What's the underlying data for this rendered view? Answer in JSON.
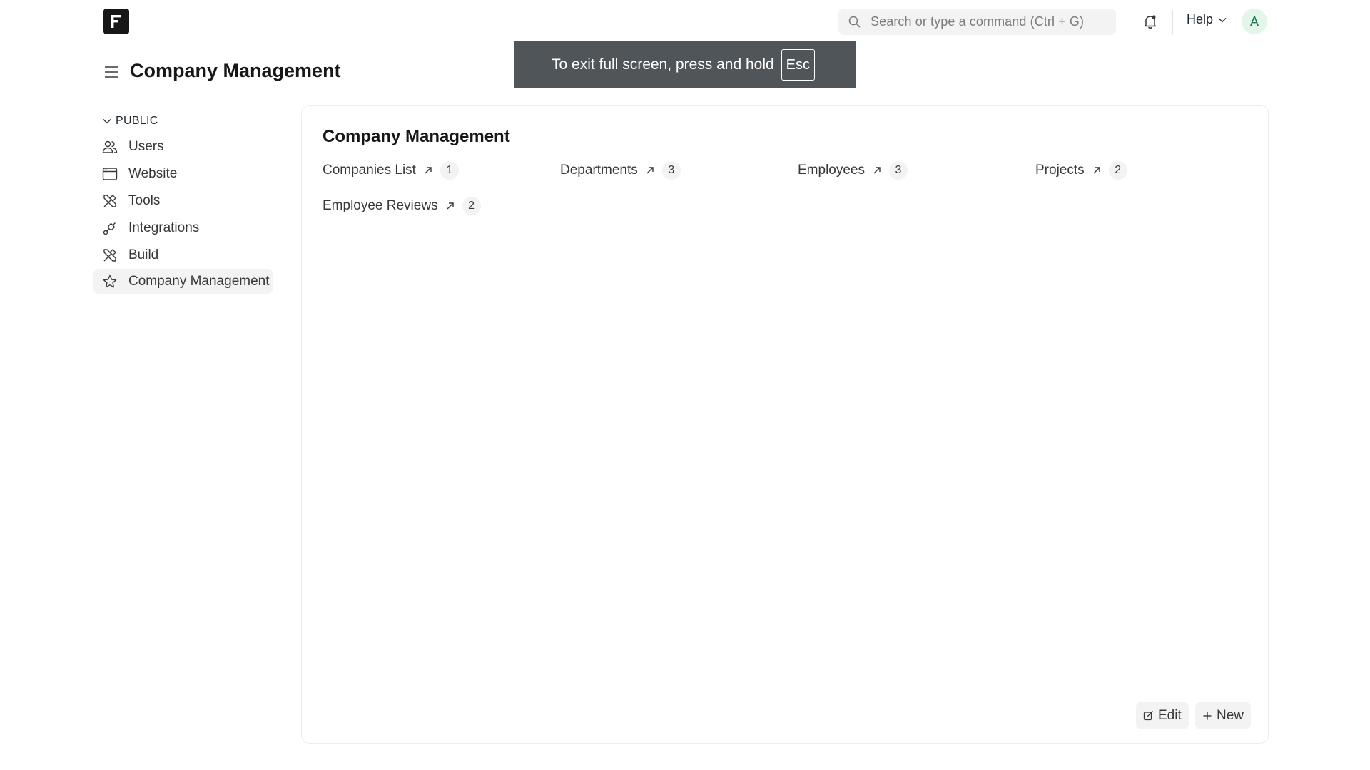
{
  "navbar": {
    "logo_icon": "frappe-logo-icon",
    "search_placeholder": "Search or type a command (Ctrl + G)",
    "help_label": "Help",
    "avatar_initial": "A"
  },
  "fullscreen_notice": {
    "text": "To exit full screen, press and hold",
    "key": "Esc"
  },
  "page": {
    "title": "Company Management"
  },
  "sidebar": {
    "section_label": "PUBLIC",
    "items": [
      {
        "label": "Users",
        "icon": "users-icon"
      },
      {
        "label": "Website",
        "icon": "browser-window-icon"
      },
      {
        "label": "Tools",
        "icon": "tools-icon"
      },
      {
        "label": "Integrations",
        "icon": "integrations-icon"
      },
      {
        "label": "Build",
        "icon": "build-icon"
      },
      {
        "label": "Company Management",
        "icon": "star-icon",
        "active": true
      }
    ]
  },
  "workspace": {
    "title": "Company Management",
    "shortcuts": [
      {
        "label": "Companies List",
        "count": "1"
      },
      {
        "label": "Departments",
        "count": "3"
      },
      {
        "label": "Employees",
        "count": "3"
      },
      {
        "label": "Projects",
        "count": "2"
      },
      {
        "label": "Employee Reviews",
        "count": "2"
      }
    ],
    "edit_label": "Edit",
    "new_label": "New"
  },
  "colors": {
    "toast_bg": "#50555a",
    "avatar_bg": "#e4f5e9",
    "avatar_fg": "#16794c",
    "active_item_bg": "#f3f3f3"
  }
}
